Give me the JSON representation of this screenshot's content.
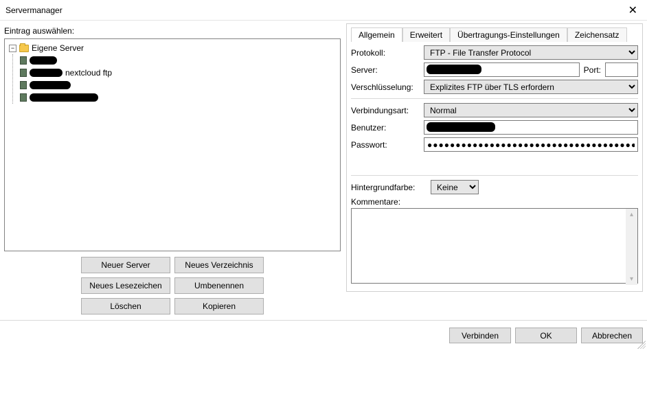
{
  "window": {
    "title": "Servermanager"
  },
  "left": {
    "label": "Eintrag auswählen:",
    "root": "Eigene Server",
    "entry_visible_text": "nextcloud ftp",
    "buttons": {
      "new_server": "Neuer Server",
      "new_dir": "Neues Verzeichnis",
      "new_bookmark": "Neues Lesezeichen",
      "rename": "Umbenennen",
      "delete": "Löschen",
      "copy": "Kopieren"
    }
  },
  "tabs": {
    "general": "Allgemein",
    "advanced": "Erweitert",
    "transfer": "Übertragungs-Einstellungen",
    "charset": "Zeichensatz"
  },
  "form": {
    "protocol_label": "Protokoll:",
    "protocol_value": "FTP - File Transfer Protocol",
    "server_label": "Server:",
    "port_label": "Port:",
    "encryption_label": "Verschlüsselung:",
    "encryption_value": "Explizites FTP über TLS erfordern",
    "logon_label": "Verbindungsart:",
    "logon_value": "Normal",
    "user_label": "Benutzer:",
    "password_label": "Passwort:",
    "password_value": "●●●●●●●●●●●●●●●●●●●●●●●●●●●●●●●●●●●●●●●●●",
    "bg_label": "Hintergrundfarbe:",
    "bg_value": "Keine",
    "comments_label": "Kommentare:"
  },
  "footer": {
    "connect": "Verbinden",
    "ok": "OK",
    "cancel": "Abbrechen"
  }
}
